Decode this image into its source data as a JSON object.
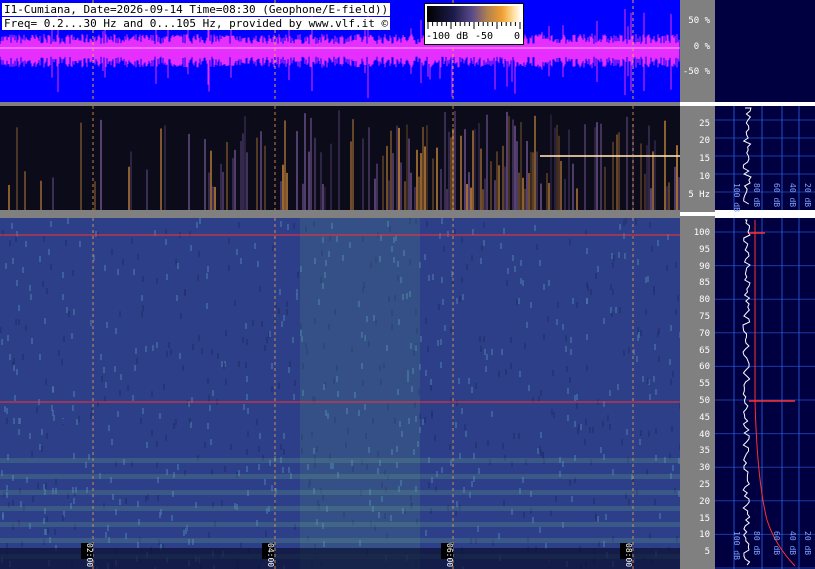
{
  "header": {
    "line1": "I1-Cumiana, Date=2026-09-14 Time=08:30 (Geophone/E-field))",
    "line2": "Freq= 0.2...30 Hz and 0...105 Hz, provided by www.vlf.it ©"
  },
  "colorbar": {
    "labels": [
      "-100 dB",
      "-50",
      "0"
    ]
  },
  "waveform_axis": {
    "labels": [
      "50 %",
      "0 %",
      "-50 %"
    ]
  },
  "top_spectrogram_axis": {
    "labels": [
      "25",
      "20",
      "15",
      "10",
      "5 Hz"
    ]
  },
  "bottom_spectrogram_axis": {
    "labels": [
      "100",
      "95",
      "90",
      "85",
      "80",
      "75",
      "70",
      "65",
      "60",
      "55",
      "50",
      "45",
      "40",
      "35",
      "30",
      "25",
      "20",
      "15",
      "10",
      "5"
    ]
  },
  "time_markers": [
    "02:00",
    "04:00",
    "06:00",
    "08:00"
  ],
  "profile_top_axis": {
    "labels": [
      "100 dB",
      "80 dB",
      "60 dB",
      "40 dB",
      "20 dB"
    ]
  },
  "profile_bottom_axis": {
    "labels": [
      "100 dB",
      "80 dB",
      "60 dB",
      "40 dB",
      "20 dB"
    ]
  },
  "colors": {
    "waveform_bg": "#0000ff",
    "waveform_trace": "#ff33ff",
    "spec_bottom_bg": "#2c3f88",
    "grid_line": "#f2a050",
    "line_50hz": "#ff3030",
    "profile_bg": "#000040",
    "profile_grid": "#3070ff"
  }
}
